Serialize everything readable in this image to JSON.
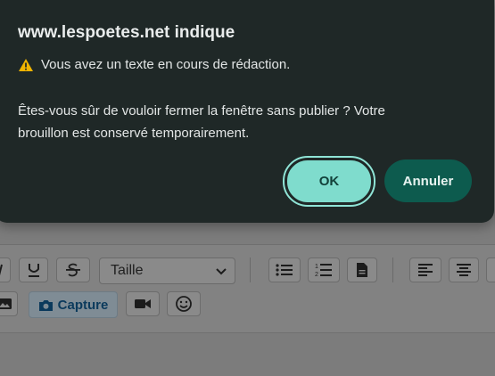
{
  "dialog": {
    "title": "www.lespoetes.net indique",
    "warning_line": "Vous avez un texte en cours de rédaction.",
    "message": "Êtes-vous sûr de vouloir fermer la fenêtre sans publier ? Votre brouillon est conservé temporairement.",
    "ok_label": "OK",
    "cancel_label": "Annuler",
    "accent_color": "#7fdccd",
    "cancel_color": "#0d5b4e"
  },
  "editor": {
    "font_size_select": "Taille",
    "capture_label": "Capture"
  }
}
